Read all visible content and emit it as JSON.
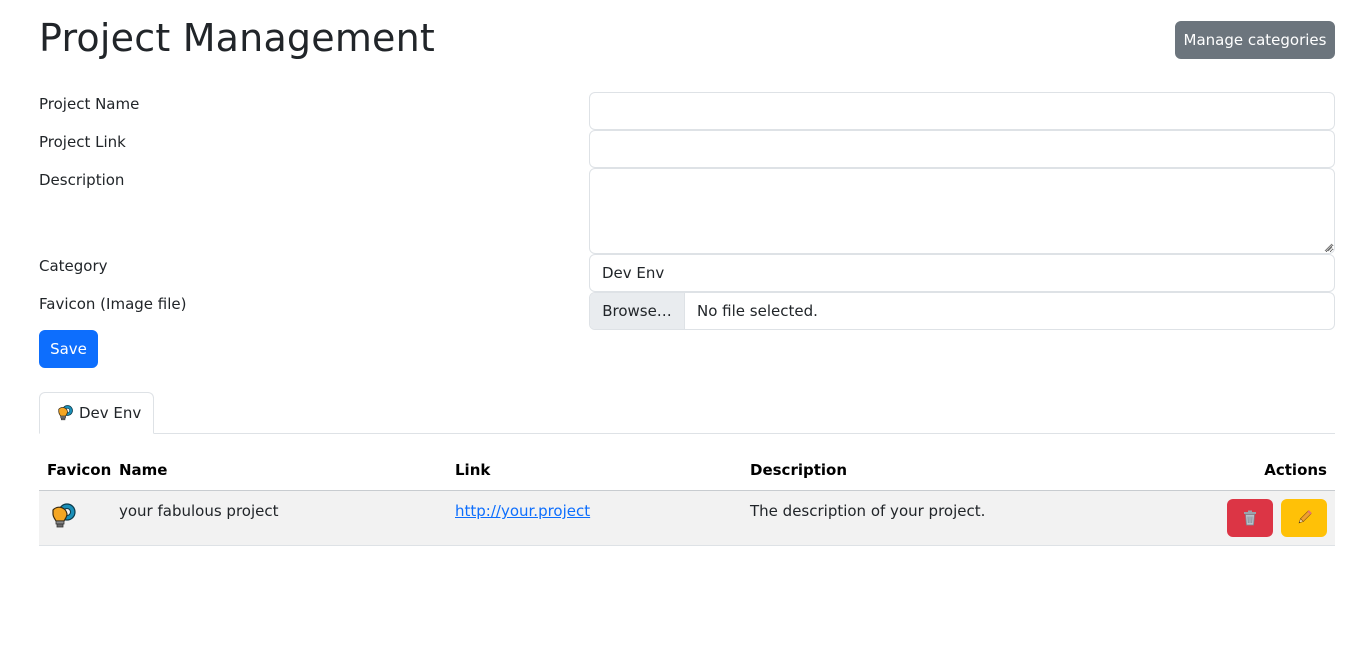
{
  "header": {
    "title": "Project Management",
    "manage_categories_label": "Manage categories"
  },
  "form": {
    "project_name_label": "Project Name",
    "project_name_value": "",
    "project_link_label": "Project Link",
    "project_link_value": "",
    "description_label": "Description",
    "description_value": "",
    "category_label": "Category",
    "category_selected": "Dev Env",
    "favicon_label": "Favicon (Image file)",
    "favicon_browse_label": "Browse…",
    "favicon_status": "No file selected.",
    "save_label": "Save"
  },
  "tabs": [
    {
      "label": "Dev Env",
      "icon": "lightbulb-gear-icon",
      "active": true
    }
  ],
  "table": {
    "columns": [
      "Favicon",
      "Name",
      "Link",
      "Description",
      "Actions"
    ],
    "rows": [
      {
        "favicon": "lightbulb-gear-icon",
        "name": "your fabulous project",
        "link": "http://your.project",
        "description": "The description of your project.",
        "actions": [
          "delete-icon",
          "edit-icon"
        ]
      }
    ]
  },
  "colors": {
    "primary": "#0d6efd",
    "secondary": "#6c757d",
    "danger": "#dc3545",
    "warning": "#ffc107"
  }
}
